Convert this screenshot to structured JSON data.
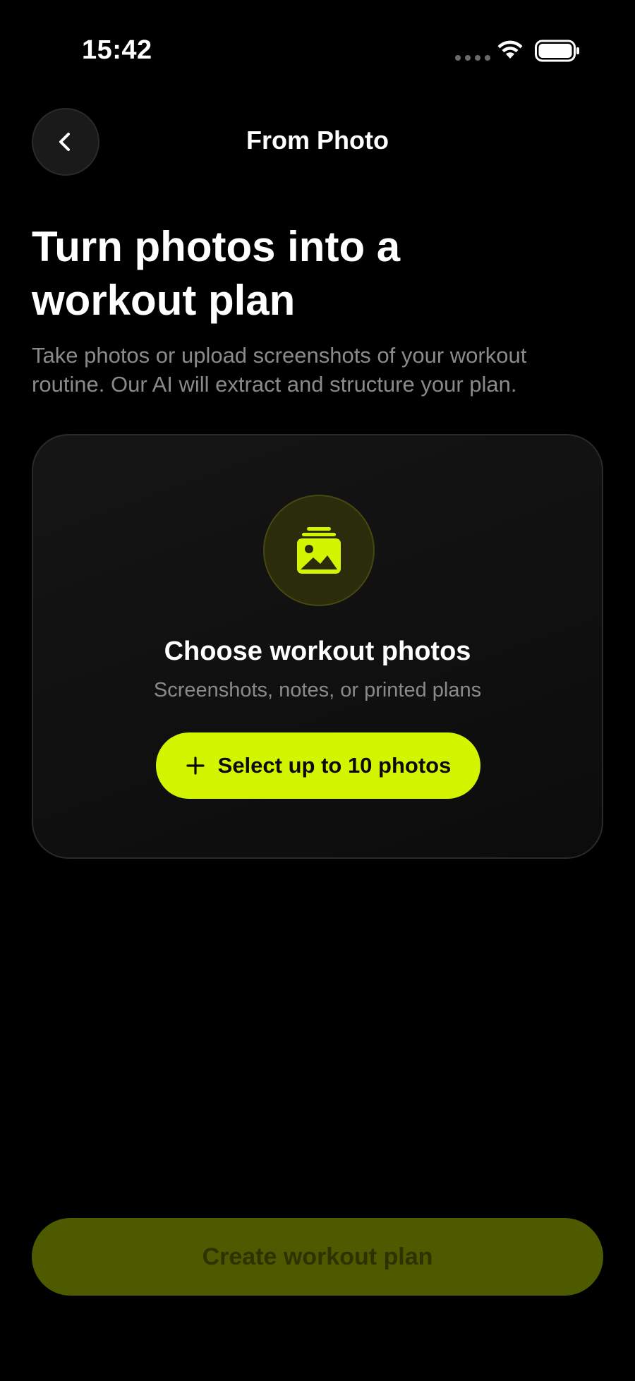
{
  "status_bar": {
    "time": "15:42",
    "icons": [
      "signal-dots-icon",
      "wifi-icon",
      "battery-icon"
    ]
  },
  "nav": {
    "back_icon": "chevron-left-icon",
    "title": "From Photo"
  },
  "header": {
    "title_line1": "Turn photos into a",
    "title_line2": "workout plan",
    "subtitle_line1": "Take photos or upload screenshots of your workout",
    "subtitle_line2": "routine. Our AI will extract and structure your plan."
  },
  "upload_card": {
    "icon": "photo-stack-icon",
    "title": "Choose workout photos",
    "subtitle": "Screenshots, notes, or printed plans",
    "button_icon": "plus-icon",
    "button_label": "Select up to 10 photos"
  },
  "footer": {
    "create_label": "Create workout plan"
  },
  "colors": {
    "accent": "#d4f500",
    "accent_disabled": "#4e5a00",
    "background": "#000000",
    "card": "#121212",
    "muted_text": "#8a8a8a"
  }
}
